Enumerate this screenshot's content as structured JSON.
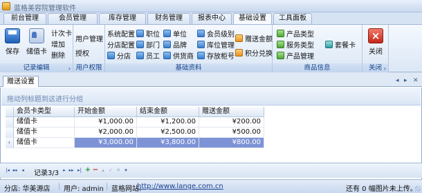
{
  "app": {
    "title": "蓝格美容院管理软件"
  },
  "ribbon_tabs": [
    {
      "label": "前台管理"
    },
    {
      "label": "会员管理"
    },
    {
      "label": "库存管理"
    },
    {
      "label": "财务管理"
    },
    {
      "label": "报表中心"
    },
    {
      "label": "基础设置",
      "active": true
    },
    {
      "label": "工具面板"
    }
  ],
  "ribbon": {
    "record_edit": {
      "label": "记录编辑",
      "save": "保存",
      "card": "储值卡",
      "timecard": "计次卡",
      "add": "增加",
      "delete": "删除"
    },
    "user_perm": {
      "label": "用户权限",
      "user_manage": "用户管理",
      "authorize": "授权"
    },
    "basic_data": {
      "label": "基础资料",
      "system_config": "系统配置",
      "branch_config": "分店配置",
      "branch": "分店",
      "position": "职位",
      "department": "部门",
      "staff": "员工",
      "unit": "单位",
      "brand": "品牌",
      "supplier": "供货商",
      "member_level": "会员级别",
      "location_manage": "库位管理",
      "locker_number": "存放柜号",
      "gift_amount": "赠送金额",
      "points_exchange": "积分兑换"
    },
    "product_info": {
      "label": "商品信息",
      "product_type": "产品类型",
      "service_type": "服务类型",
      "product_manage": "产品管理",
      "package_card": "套餐卡"
    },
    "close_group": {
      "label": "关闭",
      "close": "关闭"
    }
  },
  "doc_tab": {
    "label": "赠送设置"
  },
  "grid": {
    "group_hint": "拖动列标题到这进行分组",
    "columns": [
      "会员卡类型",
      "开始金额",
      "结束金额",
      "赠送金额"
    ],
    "rows": [
      [
        "储值卡",
        "¥1,000.00",
        "¥1,200.00",
        "¥200.00"
      ],
      [
        "储值卡",
        "¥2,000.00",
        "¥2,500.00",
        "¥500.00"
      ],
      [
        "储值卡",
        "¥3,000.00",
        "¥3,800.00",
        "¥800.00"
      ]
    ],
    "selected_row_marker": "›"
  },
  "navigator": {
    "record_text": "记录3/3",
    "buttons": [
      "first-icon",
      "prev-page-icon",
      "prev-icon",
      "next-icon",
      "next-page-icon",
      "last-icon",
      "add-icon",
      "delete-icon",
      "edit-icon",
      "confirm-icon",
      "cancel-icon",
      "filter-icon"
    ]
  },
  "status": {
    "branch_label": "分店: 华美源店",
    "user_label": "用户: admin",
    "site_label": "蓝格网站:",
    "site_url": "http://www.lange.com.cn",
    "upload_text": "还有 0 幅图片未上传。"
  },
  "colors": {
    "accent": "#15428b",
    "selection": "#7d93d6"
  }
}
